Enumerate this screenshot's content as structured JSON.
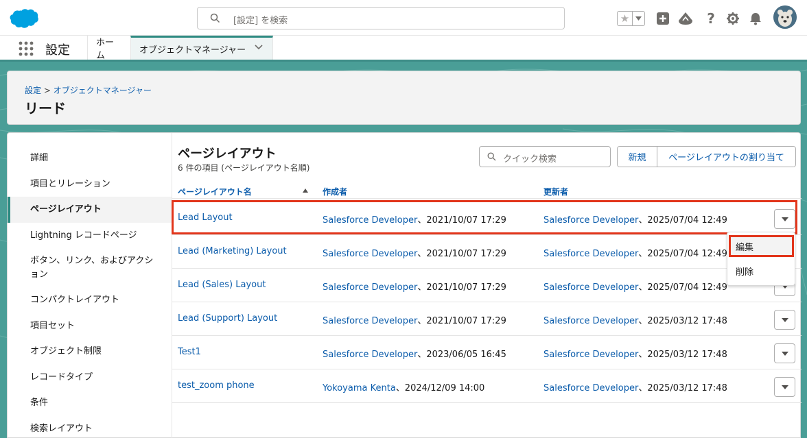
{
  "header": {
    "search_placeholder": "[設定] を検索",
    "icons": [
      "star-icon",
      "add-icon",
      "trailhead-icon",
      "help-icon",
      "gear-icon",
      "bell-icon"
    ]
  },
  "nav": {
    "app_name": "設定",
    "tabs": [
      {
        "label": "ホーム"
      },
      {
        "label": "オブジェクトマネージャー"
      }
    ]
  },
  "page": {
    "breadcrumb_root": "設定",
    "breadcrumb_sep": ">",
    "breadcrumb_current": "オブジェクトマネージャー",
    "title": "リード"
  },
  "sidebar": {
    "items": [
      {
        "label": "詳細"
      },
      {
        "label": "項目とリレーション"
      },
      {
        "label": "ページレイアウト"
      },
      {
        "label": "Lightning レコードページ"
      },
      {
        "label": "ボタン、リンク、およびアクション"
      },
      {
        "label": "コンパクトレイアウト"
      },
      {
        "label": "項目セット"
      },
      {
        "label": "オブジェクト制限"
      },
      {
        "label": "レコードタイプ"
      },
      {
        "label": "条件"
      },
      {
        "label": "検索レイアウト"
      }
    ]
  },
  "main": {
    "title": "ページレイアウト",
    "subtitle": "6 件の項目 (ページレイアウト名順)",
    "quick_search_placeholder": "クイック検索",
    "new_button": "新規",
    "assign_button": "ページレイアウトの割り当て",
    "columns": [
      "ページレイアウト名",
      "作成者",
      "更新者"
    ],
    "rows": [
      {
        "name": "Lead Layout",
        "created_by": "Salesforce Developer",
        "created_at": "、2021/10/07 17:29",
        "modified_by": "Salesforce Developer",
        "modified_at": "、2025/07/04 12:49"
      },
      {
        "name": "Lead (Marketing) Layout",
        "created_by": "Salesforce Developer",
        "created_at": "、2021/10/07 17:29",
        "modified_by": "Salesforce Developer",
        "modified_at": "、2025/07/04 12:49"
      },
      {
        "name": "Lead (Sales) Layout",
        "created_by": "Salesforce Developer",
        "created_at": "、2021/10/07 17:29",
        "modified_by": "Salesforce Developer",
        "modified_at": "、2025/07/04 12:49"
      },
      {
        "name": "Lead (Support) Layout",
        "created_by": "Salesforce Developer",
        "created_at": "、2021/10/07 17:29",
        "modified_by": "Salesforce Developer",
        "modified_at": "、2025/03/12 17:48"
      },
      {
        "name": "Test1",
        "created_by": "Salesforce Developer",
        "created_at": "、2023/06/05 16:45",
        "modified_by": "Salesforce Developer",
        "modified_at": "、2025/03/12 17:48"
      },
      {
        "name": "test_zoom phone",
        "created_by": "Yokoyama Kenta",
        "created_at": "、2024/12/09 14:00",
        "modified_by": "Salesforce Developer",
        "modified_at": "、2025/03/12 17:48"
      }
    ],
    "row_menu": {
      "items": [
        {
          "label": "編集"
        },
        {
          "label": "削除"
        }
      ]
    }
  },
  "colors": {
    "brand_link": "#0b5cab",
    "accent_teal": "#2e8b82",
    "highlight_red": "#e2351b",
    "logo_blue": "#00a1e0"
  }
}
